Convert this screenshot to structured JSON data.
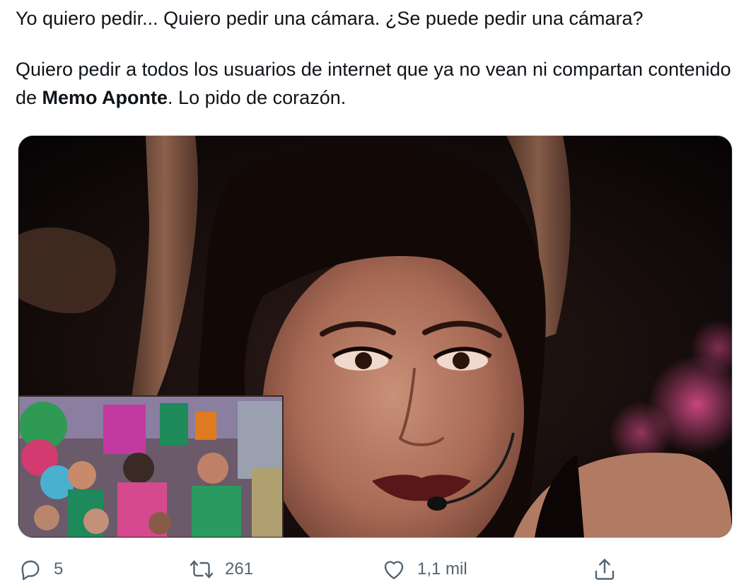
{
  "tweet": {
    "line1": "Yo quiero pedir... Quiero pedir una cámara. ¿Se puede pedir una cámara?",
    "line2_before": "Quiero pedir a todos los usuarios de internet que ya no vean ni compartan contenido de ",
    "mention": "Memo Aponte",
    "line2_after": ". Lo pido de corazón."
  },
  "actions": {
    "reply_count": "5",
    "retweet_count": "261",
    "like_count": "1,1 mil"
  },
  "colors": {
    "text": "#0f1419",
    "icon": "#536471",
    "border": "#cfd9de"
  },
  "icons": {
    "reply": "reply-bubble-icon",
    "retweet": "retweet-arrows-icon",
    "like": "heart-icon",
    "share": "share-upload-icon"
  }
}
